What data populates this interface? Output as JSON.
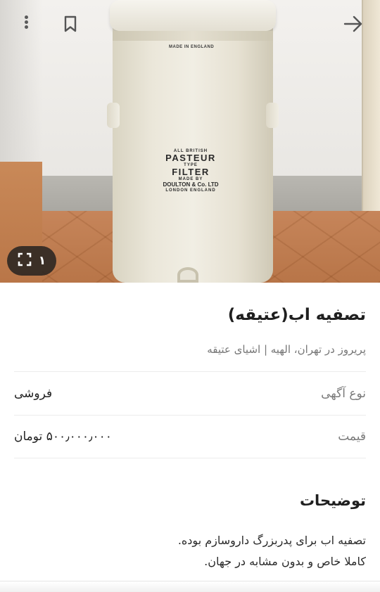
{
  "header": {
    "menu_icon": "kebab-menu-icon",
    "bookmark_icon": "bookmark-icon",
    "back_icon": "arrow-right-icon"
  },
  "photo": {
    "product_text": {
      "top_stamp": "MADE IN ENGLAND",
      "line_small_1": "ALL BRITISH",
      "line_big_1": "PASTEUR",
      "line_small_2": "TYPE",
      "line_big_2": "FILTER",
      "line_small_3": "MADE BY",
      "line_mid": "DOULTON & Co. LTD",
      "line_small_4": "LONDON ENGLAND"
    },
    "gallery": {
      "icon": "fullscreen-icon",
      "count": "۱"
    }
  },
  "listing": {
    "title": "تصفیه اب(عتیقه)",
    "subtitle": "پریروز در تهران، الهیه | اشیای عتیقه",
    "details": [
      {
        "key": "نوع آگهی",
        "value": "فروشی"
      },
      {
        "key": "قیمت",
        "value": "۵۰۰٫۰۰۰٫۰۰۰ تومان"
      }
    ],
    "description_title": "توضیحات",
    "description_lines": [
      "تصفیه اب برای پدربزرگ داروسازم بوده.",
      "کاملا خاص و بدون مشابه در جهان."
    ]
  },
  "colors": {
    "badge_bg": "#1e1e1e",
    "muted_text": "#777777",
    "divider": "#ececec"
  }
}
